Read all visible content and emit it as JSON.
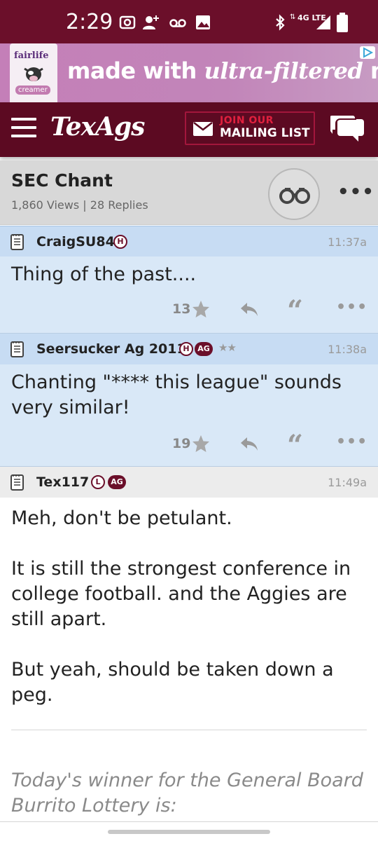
{
  "status_bar": {
    "time": "2:29",
    "network": "4G LTE",
    "icons": [
      "camera-icon",
      "add-person-icon",
      "voicemail-icon",
      "image-icon",
      "bluetooth-icon",
      "signal-icon",
      "battery-icon"
    ]
  },
  "ad": {
    "brand": "fairlife",
    "product": "creamer",
    "text_prefix": "made with",
    "text_italic": "ultra-filtered",
    "text_suffix": "milk"
  },
  "header": {
    "logo": "TexAgs",
    "mailing_line1": "JOIN OUR",
    "mailing_line2": "MAILING LIST",
    "colors": {
      "maroon": "#5c0a22",
      "accent": "#a2163c"
    }
  },
  "thread": {
    "title": "SEC Chant",
    "stats": "1,860 Views | 28 Replies",
    "more": "•••"
  },
  "posts": [
    {
      "username": "CraigSU84",
      "badges": [
        "H"
      ],
      "time": "11:37a",
      "body": "Thing of the past....",
      "likes": "13"
    },
    {
      "username": "Seersucker Ag 2011",
      "badges": [
        "H",
        "AG"
      ],
      "stars": "★★",
      "time": "11:38a",
      "body_line1": "Chanting \"**** this league\" sounds",
      "body_line2": "very similar!",
      "likes": "19"
    },
    {
      "username": "Tex117",
      "badges": [
        "L",
        "AG"
      ],
      "time": "11:49a",
      "body_p1": "Meh, don't be petulant.",
      "body_p2_l1": "It is still the strongest conference in",
      "body_p2_l2": "college football. and the Aggies are",
      "body_p2_l3": "still apart.",
      "body_p3_l1": "But yeah, should be taken down a",
      "body_p3_l2": "peg."
    }
  ],
  "signature": {
    "line1": "Today's winner for the General Board",
    "line2": "Burrito Lottery is:"
  },
  "action_glyphs": {
    "quote": "“",
    "more": "•••"
  }
}
